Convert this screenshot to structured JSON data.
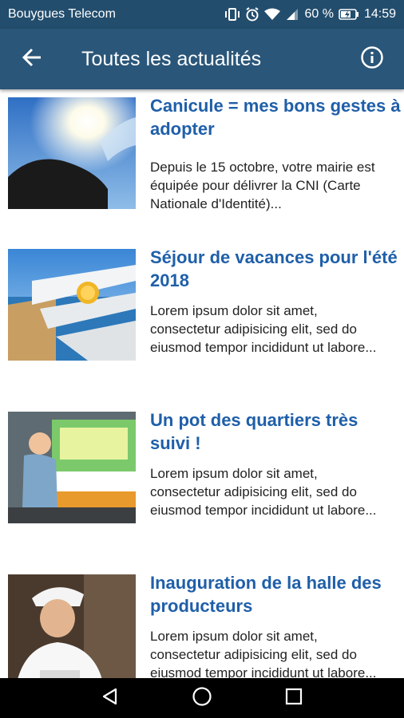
{
  "status_bar": {
    "carrier": "Bouygues Telecom",
    "battery": "60 %",
    "time": "14:59",
    "icons": [
      "vibrate-icon",
      "alarm-icon",
      "wifi-icon",
      "signal-icon",
      "battery-charging-icon"
    ]
  },
  "app_bar": {
    "title": "Toutes les actualités",
    "back_icon": "arrow-back-icon",
    "info_icon": "info-icon"
  },
  "articles": [
    {
      "title": "Canicule = mes bons gestes à adopter",
      "excerpt": "Depuis le 15 octobre, votre mairie est équipée pour délivrer la CNI (Carte Nationale d'Identité)...",
      "image": "sun-and-water-photo"
    },
    {
      "title": "Séjour de vacances pour l'été 2018",
      "excerpt": "Lorem ipsum dolor sit amet, consectetur adipisicing elit, sed do eiusmod tempor incididunt ut labore...",
      "image": "pier-photo"
    },
    {
      "title": "Un pot des quartiers très suivi !",
      "excerpt": "Lorem ipsum dolor sit amet, consectetur adipisicing elit, sed do eiusmod tempor incididunt ut labore...",
      "image": "street-piano-photo"
    },
    {
      "title": "Inauguration de la halle des producteurs",
      "excerpt": "Lorem ipsum dolor sit amet, consectetur adipisicing elit, sed do eiusmod tempor incididunt ut labore...",
      "image": "market-woman-photo"
    }
  ],
  "nav_bar": {
    "icons": [
      "back-triangle-icon",
      "home-circle-icon",
      "recents-square-icon"
    ]
  },
  "colors": {
    "status_bar": "#234d6d",
    "app_bar": "#2a5679",
    "title_text": "#1f5fa9"
  }
}
